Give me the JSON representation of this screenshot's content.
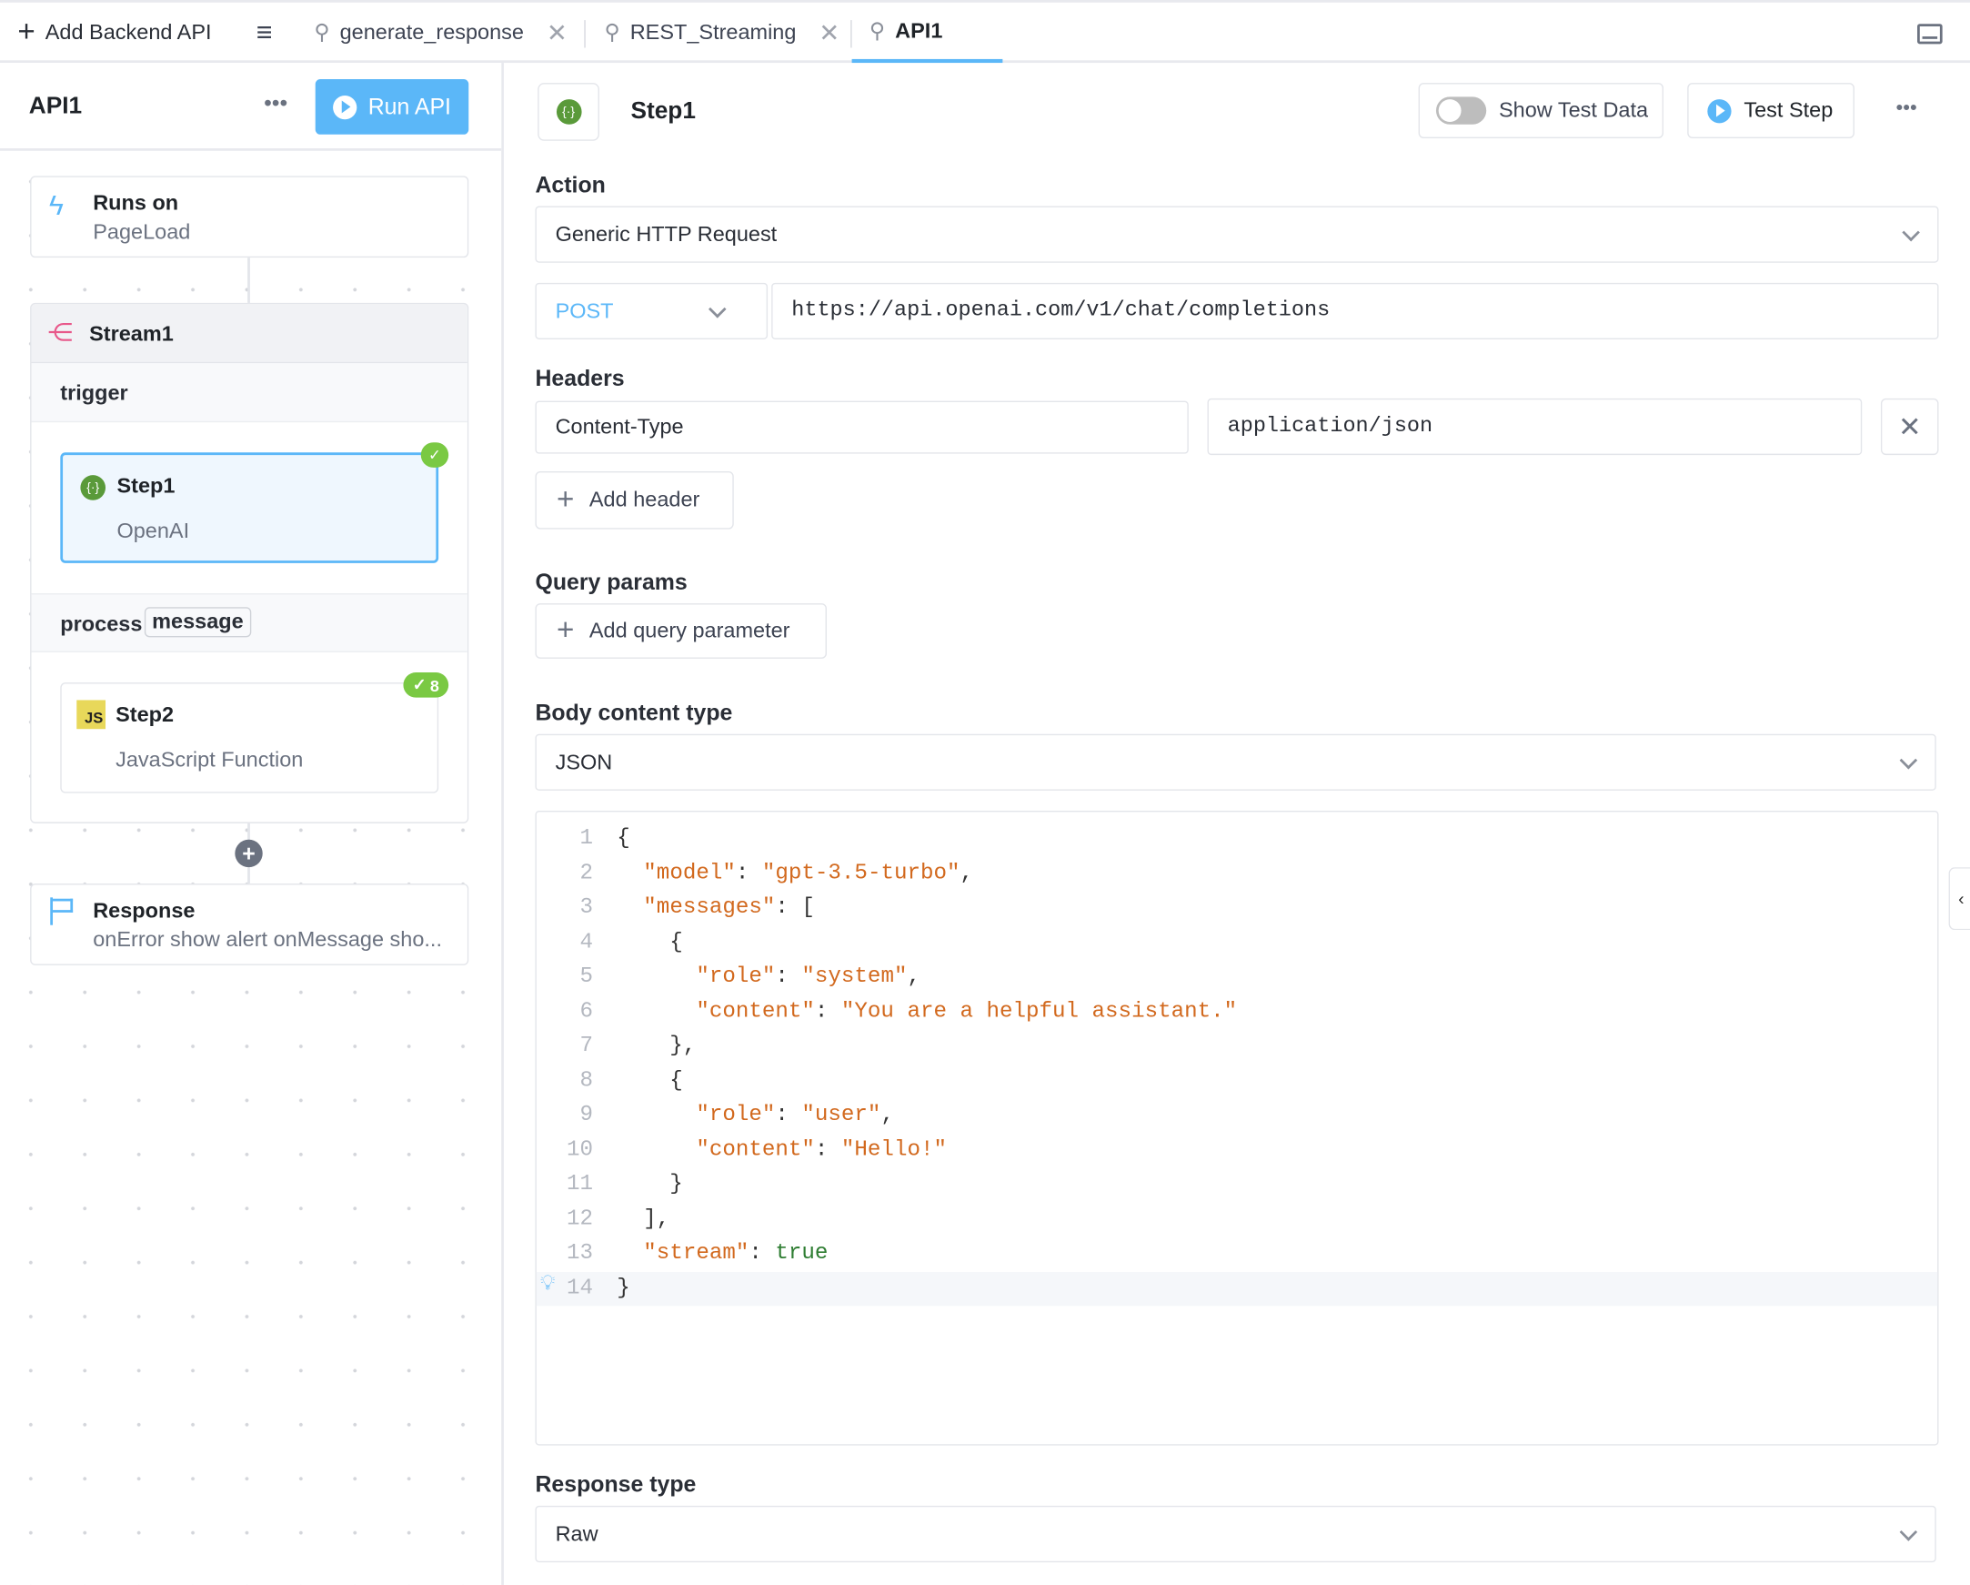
{
  "tabbar": {
    "add_label": "Add Backend API",
    "tabs": [
      {
        "label": "generate_response",
        "closable": true
      },
      {
        "label": "REST_Streaming",
        "closable": true
      },
      {
        "label": "API1",
        "active": true
      }
    ]
  },
  "left": {
    "title": "API1",
    "run_label": "Run API",
    "trigger": {
      "title": "Runs on",
      "value": "PageLoad"
    },
    "stream": {
      "title": "Stream1",
      "trigger_label": "trigger",
      "process_label": "process",
      "process_param": "message",
      "step1": {
        "name": "Step1",
        "type": "OpenAI"
      },
      "step2": {
        "name": "Step2",
        "type": "JavaScript Function",
        "icon_text": "JS",
        "badge": "8"
      }
    },
    "response": {
      "title": "Response",
      "value": "onError show alert onMessage sho..."
    }
  },
  "step": {
    "title": "Step1",
    "show_test_data": "Show Test Data",
    "test_step": "Test Step",
    "show_test_data_on": false
  },
  "form": {
    "action_label": "Action",
    "action_value": "Generic HTTP Request",
    "method": "POST",
    "url": "https://api.openai.com/v1/chat/completions",
    "headers_label": "Headers",
    "header_key": "Content-Type",
    "header_value": "application/json",
    "add_header": "Add header",
    "query_label": "Query params",
    "add_query": "Add query parameter",
    "body_type_label": "Body content type",
    "body_type": "JSON",
    "response_type_label": "Response type",
    "response_type": "Raw"
  },
  "code": [
    {
      "n": "1",
      "t": [
        [
          "p",
          "{"
        ]
      ]
    },
    {
      "n": "2",
      "t": [
        [
          "p",
          "  "
        ],
        [
          "k",
          "\"model\""
        ],
        [
          "p",
          ": "
        ],
        [
          "s",
          "\"gpt-3.5-turbo\""
        ],
        [
          "p",
          ","
        ]
      ]
    },
    {
      "n": "3",
      "t": [
        [
          "p",
          "  "
        ],
        [
          "k",
          "\"messages\""
        ],
        [
          "p",
          ": ["
        ]
      ]
    },
    {
      "n": "4",
      "t": [
        [
          "p",
          "    {"
        ]
      ]
    },
    {
      "n": "5",
      "t": [
        [
          "p",
          "      "
        ],
        [
          "k",
          "\"role\""
        ],
        [
          "p",
          ": "
        ],
        [
          "s",
          "\"system\""
        ],
        [
          "p",
          ","
        ]
      ]
    },
    {
      "n": "6",
      "t": [
        [
          "p",
          "      "
        ],
        [
          "k",
          "\"content\""
        ],
        [
          "p",
          ": "
        ],
        [
          "s",
          "\"You are a helpful assistant.\""
        ]
      ]
    },
    {
      "n": "7",
      "t": [
        [
          "p",
          "    },"
        ]
      ]
    },
    {
      "n": "8",
      "t": [
        [
          "p",
          "    {"
        ]
      ]
    },
    {
      "n": "9",
      "t": [
        [
          "p",
          "      "
        ],
        [
          "k",
          "\"role\""
        ],
        [
          "p",
          ": "
        ],
        [
          "s",
          "\"user\""
        ],
        [
          "p",
          ","
        ]
      ]
    },
    {
      "n": "10",
      "t": [
        [
          "p",
          "      "
        ],
        [
          "k",
          "\"content\""
        ],
        [
          "p",
          ": "
        ],
        [
          "s",
          "\"Hello!\""
        ]
      ]
    },
    {
      "n": "11",
      "t": [
        [
          "p",
          "    }"
        ]
      ]
    },
    {
      "n": "12",
      "t": [
        [
          "p",
          "  ],"
        ]
      ]
    },
    {
      "n": "13",
      "t": [
        [
          "p",
          "  "
        ],
        [
          "k",
          "\"stream\""
        ],
        [
          "p",
          ": "
        ],
        [
          "b",
          "true"
        ]
      ]
    },
    {
      "n": "14",
      "t": [
        [
          "p",
          "}"
        ]
      ]
    }
  ],
  "colors": {
    "accent": "#5bb7f8",
    "success": "#7ac943",
    "string": "#d2691e",
    "boolean": "#2e7d32"
  }
}
